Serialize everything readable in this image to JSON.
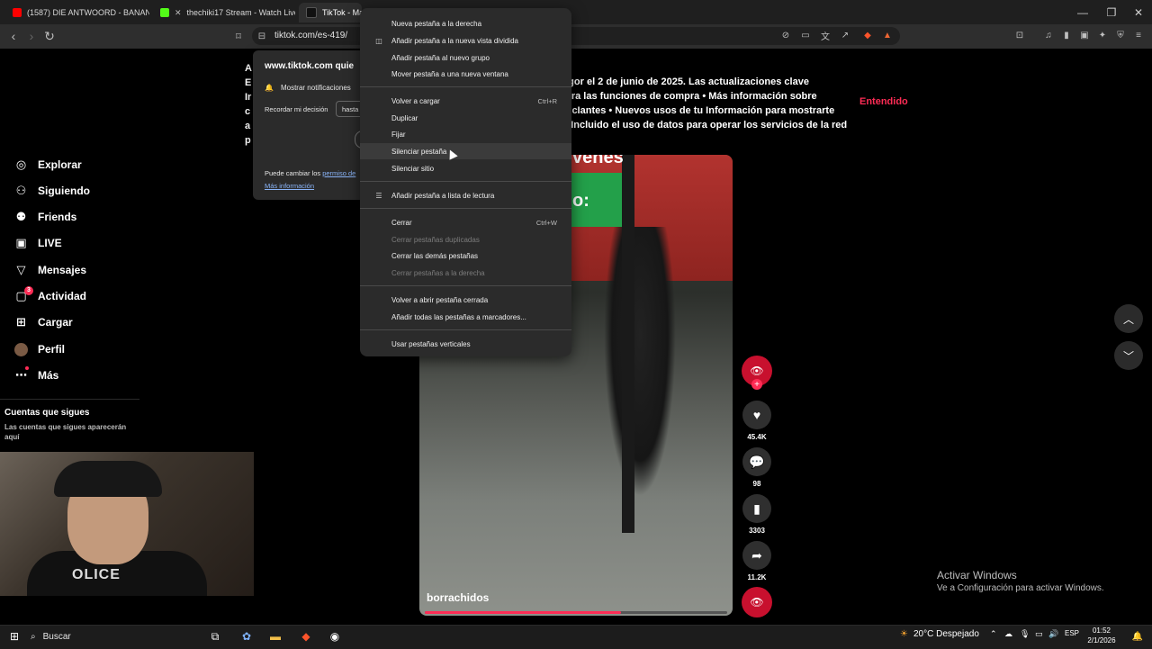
{
  "browser": {
    "tabs": [
      {
        "label": "(1587) DIE ANTWOORD - BANANA B",
        "color": "#ff0000"
      },
      {
        "label": "thechiki17 Stream - Watch Live o",
        "color": "#53fc18"
      },
      {
        "label": "TikTok - Ma",
        "color": "#111111"
      }
    ],
    "url": "tiktok.com/es-419/"
  },
  "sidebar": {
    "items": [
      {
        "label": "Explorar",
        "icon": "compass"
      },
      {
        "label": "Siguiendo",
        "icon": "following"
      },
      {
        "label": "Friends",
        "icon": "friends"
      },
      {
        "label": "LIVE",
        "icon": "live"
      },
      {
        "label": "Mensajes",
        "icon": "messages"
      },
      {
        "label": "Actividad",
        "icon": "activity",
        "badge": "3"
      },
      {
        "label": "Cargar",
        "icon": "upload"
      },
      {
        "label": "Perfil",
        "icon": "avatar"
      },
      {
        "label": "Más",
        "icon": "more"
      }
    ],
    "following_heading": "Cuentas que sigues",
    "following_sub": "Las cuentas que sigues aparecerán aquí"
  },
  "notice": {
    "left_col": [
      "A",
      "E",
      "Ir",
      "c",
      "a",
      "p"
    ],
    "lines": [
      "vigor el 2 de junio de 2025. Las actualizaciones clave",
      "para las funciones de compra • Más información sobre",
      "uncIantes • Nuevos usos de tu Información para mostrarte",
      "s, Incluido el uso de datos para operar los servicios de la red"
    ],
    "dismiss": "Entendido",
    "video_overlay_1": "venes",
    "video_overlay_2": "o:"
  },
  "video": {
    "caption": "borrachidos",
    "progress": 0.65,
    "actions": {
      "likes": "45.4K",
      "comments": "98",
      "saves": "3303",
      "shares": "11.2K"
    }
  },
  "permission_popup": {
    "site": "www.tiktok.com quie",
    "notify": "Mostrar notificaciones",
    "remember": "Recordar mi decisión",
    "remember_value": "hasta",
    "footer_prefix": "Puede cambiar los",
    "footer_link": "permiso de",
    "more_info": "Más información"
  },
  "context_menu": {
    "groups": [
      [
        {
          "label": "Nueva pestaña a la derecha"
        },
        {
          "label": "Añadir pestaña a la nueva vista dividida",
          "icon": "split-view"
        },
        {
          "label": "Añadir pestaña al nuevo grupo"
        },
        {
          "label": "Mover pestaña a una nueva ventana"
        }
      ],
      [
        {
          "label": "Volver a cargar",
          "shortcut": "Ctrl+R"
        },
        {
          "label": "Duplicar"
        },
        {
          "label": "Fijar"
        },
        {
          "label": "Silenciar pestaña",
          "hover": true
        },
        {
          "label": "Silenciar sitio"
        }
      ],
      [
        {
          "label": "Añadir pestaña a lista de lectura",
          "icon": "reading-list"
        }
      ],
      [
        {
          "label": "Cerrar",
          "shortcut": "Ctrl+W"
        },
        {
          "label": "Cerrar pestañas duplicadas",
          "disabled": true
        },
        {
          "label": "Cerrar las demás pestañas"
        },
        {
          "label": "Cerrar pestañas a la derecha",
          "disabled": true
        }
      ],
      [
        {
          "label": "Volver a abrir pestaña cerrada"
        },
        {
          "label": "Añadir todas las pestañas a marcadores..."
        }
      ],
      [
        {
          "label": "Usar pestañas verticales"
        }
      ]
    ]
  },
  "webcam": {
    "shirt_text": "OLICE"
  },
  "watermark": {
    "title": "Activar Windows",
    "subtitle": "Ve a Configuración para activar Windows."
  },
  "taskbar": {
    "search": "Buscar",
    "weather": "20°C  Despejado",
    "lang": "ESP",
    "time": "01:52",
    "date": "2/1/2026"
  },
  "colors": {
    "accent": "#fe2c55",
    "menu_bg": "#2b2b2b"
  }
}
